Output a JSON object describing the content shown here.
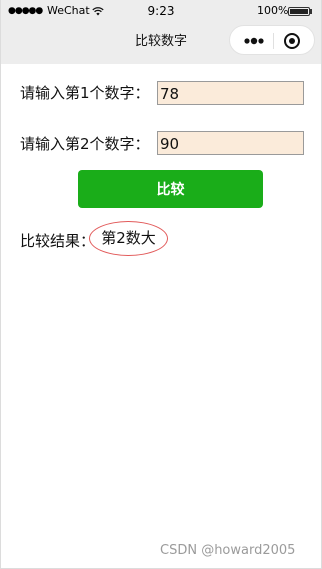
{
  "status_bar": {
    "signal": "●●●●●",
    "carrier": "WeChat",
    "time": "9:23",
    "battery": "100%"
  },
  "nav": {
    "title": "比较数字"
  },
  "form": {
    "label1": "请输入第1个数字：",
    "value1": "78",
    "label2": "请输入第2个数字：",
    "value2": "90",
    "button": "比较"
  },
  "result": {
    "label": "比较结果：",
    "value": "第2数大"
  },
  "watermark": "CSDN @howard2005",
  "colors": {
    "button_bg": "#1aad19",
    "input_bg": "#fbebda",
    "circle": "#e25b5b"
  }
}
